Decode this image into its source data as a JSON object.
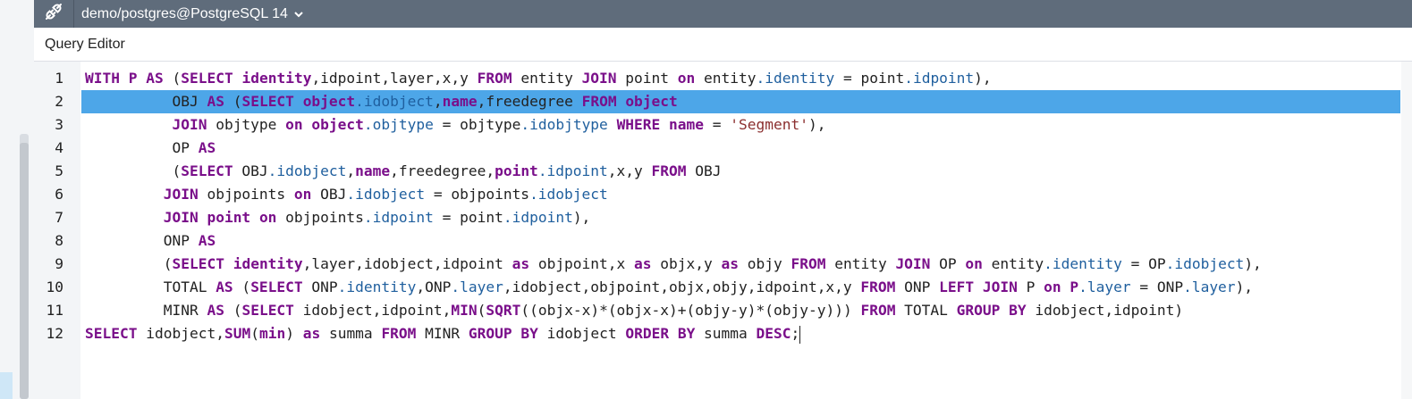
{
  "connection": {
    "icon": "plug-icon",
    "label": "demo/postgres@PostgreSQL 14"
  },
  "editor": {
    "title": "Query Editor",
    "active_line": 2,
    "lines": [
      {
        "n": "1",
        "tokens": [
          [
            "kw",
            "WITH"
          ],
          [
            "t",
            " "
          ],
          [
            "kw",
            "P"
          ],
          [
            "t",
            " "
          ],
          [
            "kw",
            "AS"
          ],
          [
            "t",
            " ("
          ],
          [
            "kw",
            "SELECT"
          ],
          [
            "t",
            " "
          ],
          [
            "kw",
            "identity"
          ],
          [
            "t",
            ",idpoint,layer,x,y "
          ],
          [
            "kw",
            "FROM"
          ],
          [
            "t",
            " entity "
          ],
          [
            "kw",
            "JOIN"
          ],
          [
            "t",
            " point "
          ],
          [
            "kw",
            "on"
          ],
          [
            "t",
            " entity"
          ],
          [
            "prop",
            ".identity"
          ],
          [
            "t",
            " = point"
          ],
          [
            "prop",
            ".idpoint"
          ],
          [
            "t",
            "),"
          ]
        ]
      },
      {
        "n": "2",
        "tokens": [
          [
            "t",
            "          OBJ "
          ],
          [
            "kw",
            "AS"
          ],
          [
            "t",
            " ("
          ],
          [
            "kw",
            "SELECT"
          ],
          [
            "t",
            " "
          ],
          [
            "kw",
            "object"
          ],
          [
            "prop",
            ".idobject"
          ],
          [
            "t",
            ","
          ],
          [
            "kw",
            "name"
          ],
          [
            "t",
            ",freedegree "
          ],
          [
            "kw",
            "FROM"
          ],
          [
            "t",
            " "
          ],
          [
            "kw",
            "object"
          ]
        ]
      },
      {
        "n": "3",
        "tokens": [
          [
            "t",
            "          "
          ],
          [
            "kw",
            "JOIN"
          ],
          [
            "t",
            " objtype "
          ],
          [
            "kw",
            "on"
          ],
          [
            "t",
            " "
          ],
          [
            "kw",
            "object"
          ],
          [
            "prop",
            ".objtype"
          ],
          [
            "t",
            " = objtype"
          ],
          [
            "prop",
            ".idobjtype"
          ],
          [
            "t",
            " "
          ],
          [
            "kw",
            "WHERE"
          ],
          [
            "t",
            " "
          ],
          [
            "kw",
            "name"
          ],
          [
            "t",
            " = "
          ],
          [
            "str",
            "'Segment'"
          ],
          [
            "t",
            "),"
          ]
        ]
      },
      {
        "n": "4",
        "tokens": [
          [
            "t",
            "          OP "
          ],
          [
            "kw",
            "AS"
          ]
        ]
      },
      {
        "n": "5",
        "tokens": [
          [
            "t",
            "          ("
          ],
          [
            "kw",
            "SELECT"
          ],
          [
            "t",
            " OBJ"
          ],
          [
            "prop",
            ".idobject"
          ],
          [
            "t",
            ","
          ],
          [
            "kw",
            "name"
          ],
          [
            "t",
            ",freedegree,"
          ],
          [
            "kw",
            "point"
          ],
          [
            "prop",
            ".idpoint"
          ],
          [
            "t",
            ",x,y "
          ],
          [
            "kw",
            "FROM"
          ],
          [
            "t",
            " OBJ"
          ]
        ]
      },
      {
        "n": "6",
        "tokens": [
          [
            "t",
            "         "
          ],
          [
            "kw",
            "JOIN"
          ],
          [
            "t",
            " objpoints "
          ],
          [
            "kw",
            "on"
          ],
          [
            "t",
            " OBJ"
          ],
          [
            "prop",
            ".idobject"
          ],
          [
            "t",
            " = objpoints"
          ],
          [
            "prop",
            ".idobject"
          ]
        ]
      },
      {
        "n": "7",
        "tokens": [
          [
            "t",
            "         "
          ],
          [
            "kw",
            "JOIN"
          ],
          [
            "t",
            " "
          ],
          [
            "kw",
            "point"
          ],
          [
            "t",
            " "
          ],
          [
            "kw",
            "on"
          ],
          [
            "t",
            " objpoints"
          ],
          [
            "prop",
            ".idpoint"
          ],
          [
            "t",
            " = point"
          ],
          [
            "prop",
            ".idpoint"
          ],
          [
            "t",
            "),"
          ]
        ]
      },
      {
        "n": "8",
        "tokens": [
          [
            "t",
            "         ONP "
          ],
          [
            "kw",
            "AS"
          ]
        ]
      },
      {
        "n": "9",
        "tokens": [
          [
            "t",
            "         ("
          ],
          [
            "kw",
            "SELECT"
          ],
          [
            "t",
            " "
          ],
          [
            "kw",
            "identity"
          ],
          [
            "t",
            ",layer,idobject,idpoint "
          ],
          [
            "kw",
            "as"
          ],
          [
            "t",
            " objpoint,x "
          ],
          [
            "kw",
            "as"
          ],
          [
            "t",
            " objx,y "
          ],
          [
            "kw",
            "as"
          ],
          [
            "t",
            " objy "
          ],
          [
            "kw",
            "FROM"
          ],
          [
            "t",
            " entity "
          ],
          [
            "kw",
            "JOIN"
          ],
          [
            "t",
            " OP "
          ],
          [
            "kw",
            "on"
          ],
          [
            "t",
            " entity"
          ],
          [
            "prop",
            ".identity"
          ],
          [
            "t",
            " = OP"
          ],
          [
            "prop",
            ".idobject"
          ],
          [
            "t",
            "),"
          ]
        ]
      },
      {
        "n": "10",
        "tokens": [
          [
            "t",
            "         TOTAL "
          ],
          [
            "kw",
            "AS"
          ],
          [
            "t",
            " ("
          ],
          [
            "kw",
            "SELECT"
          ],
          [
            "t",
            " ONP"
          ],
          [
            "prop",
            ".identity"
          ],
          [
            "t",
            ",ONP"
          ],
          [
            "prop",
            ".layer"
          ],
          [
            "t",
            ",idobject,objpoint,objx,objy,idpoint,x,y "
          ],
          [
            "kw",
            "FROM"
          ],
          [
            "t",
            " ONP "
          ],
          [
            "kw",
            "LEFT JOIN"
          ],
          [
            "t",
            " P "
          ],
          [
            "kw",
            "on"
          ],
          [
            "t",
            " "
          ],
          [
            "kw",
            "P"
          ],
          [
            "prop",
            ".layer"
          ],
          [
            "t",
            " = ONP"
          ],
          [
            "prop",
            ".layer"
          ],
          [
            "t",
            "),"
          ]
        ]
      },
      {
        "n": "11",
        "tokens": [
          [
            "t",
            "         MINR "
          ],
          [
            "kw",
            "AS"
          ],
          [
            "t",
            " ("
          ],
          [
            "kw",
            "SELECT"
          ],
          [
            "t",
            " idobject,idpoint,"
          ],
          [
            "kw",
            "MIN"
          ],
          [
            "t",
            "("
          ],
          [
            "kw",
            "SQRT"
          ],
          [
            "t",
            "((objx-x)*(objx-x)+(objy-y)*(objy-y))) "
          ],
          [
            "kw",
            "FROM"
          ],
          [
            "t",
            " TOTAL "
          ],
          [
            "kw",
            "GROUP BY"
          ],
          [
            "t",
            " idobject,idpoint)"
          ]
        ]
      },
      {
        "n": "12",
        "tokens": [
          [
            "kw",
            "SELECT"
          ],
          [
            "t",
            " idobject,"
          ],
          [
            "kw",
            "SUM"
          ],
          [
            "t",
            "("
          ],
          [
            "kw",
            "min"
          ],
          [
            "t",
            ") "
          ],
          [
            "kw",
            "as"
          ],
          [
            "t",
            " summa "
          ],
          [
            "kw",
            "FROM"
          ],
          [
            "t",
            " MINR "
          ],
          [
            "kw",
            "GROUP BY"
          ],
          [
            "t",
            " idobject "
          ],
          [
            "kw",
            "ORDER BY"
          ],
          [
            "t",
            " summa "
          ],
          [
            "kw",
            "DESC"
          ],
          [
            "t",
            ";"
          ]
        ]
      }
    ]
  }
}
